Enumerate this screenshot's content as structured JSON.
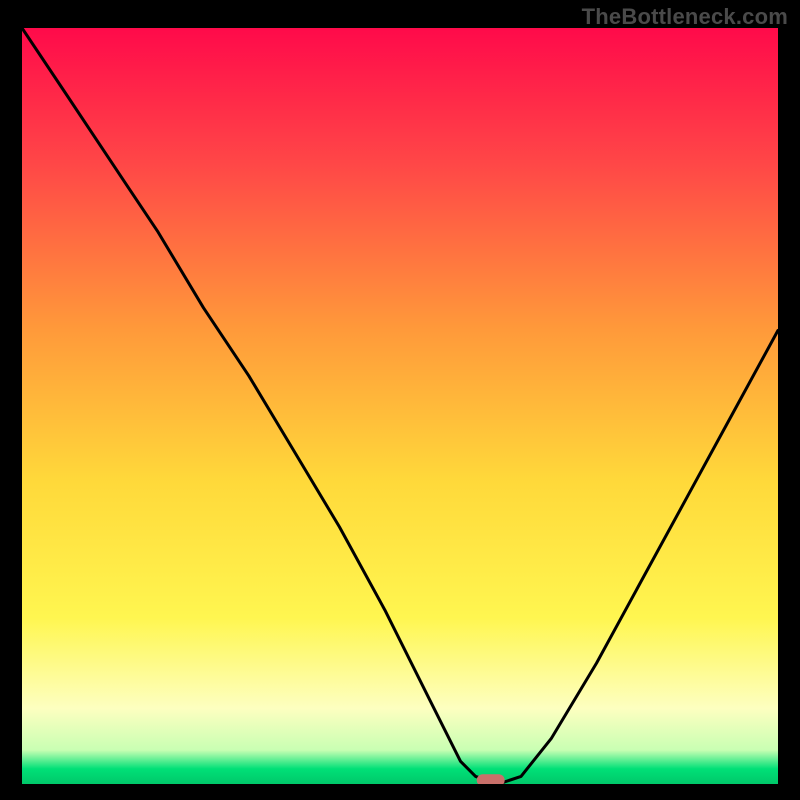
{
  "watermark": "TheBottleneck.com",
  "chart_data": {
    "type": "line",
    "title": "",
    "xlabel": "",
    "ylabel": "",
    "xlim": [
      0,
      100
    ],
    "ylim": [
      0,
      100
    ],
    "grid": false,
    "legend": false,
    "background_gradient": {
      "stops": [
        {
          "pos": 0.0,
          "color": "#ff0a4a"
        },
        {
          "pos": 0.18,
          "color": "#ff4747"
        },
        {
          "pos": 0.4,
          "color": "#ff9a3a"
        },
        {
          "pos": 0.6,
          "color": "#ffd93a"
        },
        {
          "pos": 0.78,
          "color": "#fff650"
        },
        {
          "pos": 0.9,
          "color": "#fdffc0"
        },
        {
          "pos": 0.955,
          "color": "#c9ffb3"
        },
        {
          "pos": 0.98,
          "color": "#00e077"
        },
        {
          "pos": 1.0,
          "color": "#00c86a"
        }
      ]
    },
    "series": [
      {
        "name": "bottleneck-curve",
        "color": "#000000",
        "x": [
          0,
          6,
          12,
          18,
          24,
          30,
          36,
          42,
          48,
          54,
          58,
          60,
          63,
          66,
          70,
          76,
          82,
          88,
          94,
          100
        ],
        "y": [
          100,
          91,
          82,
          73,
          63,
          54,
          44,
          34,
          23,
          11,
          3,
          1,
          0,
          1,
          6,
          16,
          27,
          38,
          49,
          60
        ]
      }
    ],
    "marker": {
      "name": "min-point",
      "x": 62,
      "y": 0.5,
      "color": "#c9706a",
      "shape": "pill"
    }
  }
}
